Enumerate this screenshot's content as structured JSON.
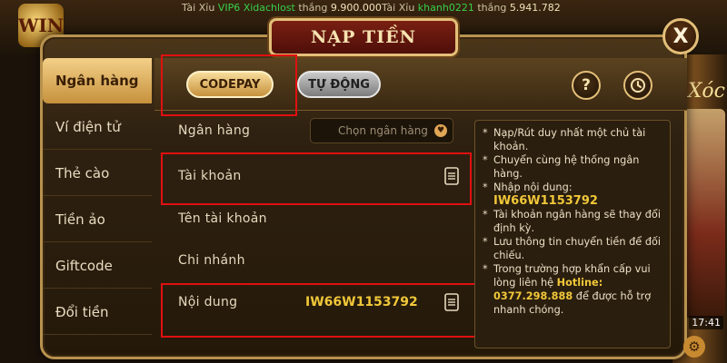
{
  "ticker": [
    {
      "prefix": "Tài Xỉu",
      "user": "VIP6 Xidachlost",
      "mid": "thắng",
      "amount": "9.900.000"
    },
    {
      "prefix": "Tài Xỉu",
      "user": "khanh0221",
      "mid": "thắng",
      "amount": "5.941.782"
    }
  ],
  "logo_text": "WIN",
  "side": {
    "title": "Xóc",
    "time": "17:41"
  },
  "dialog": {
    "title": "NẠP TIỀN",
    "close": "X"
  },
  "nav": [
    "Ngân hàng",
    "Ví điện tử",
    "Thẻ cào",
    "Tiền ảo",
    "Giftcode",
    "Đổi tiền"
  ],
  "tabs": {
    "codepay": "CODEPAY",
    "auto": "TỰ ĐỘNG",
    "help": "?"
  },
  "form": {
    "bank_label": "Ngân hàng",
    "bank_placeholder": "Chọn ngân hàng",
    "account_label": "Tài khoản",
    "account_name_label": "Tên tài khoản",
    "branch_label": "Chi nhánh",
    "content_label": "Nội dung",
    "content_value": "IW66W1153792"
  },
  "notes": {
    "n1": "Nạp/Rút duy nhất một chủ tài khoản.",
    "n2": "Chuyển cùng hệ thống ngân hàng.",
    "n3_prefix": "Nhập nội dung:",
    "n3_code": "IW66W1153792",
    "n4": "Tài khoản ngân hàng sẽ thay đổi định kỳ.",
    "n5": "Lưu thông tin chuyển tiền để đối chiếu.",
    "n6_prefix": "Trong trường hợp khẩn cấp vui lòng liên hệ",
    "n6_hotline": "Hotline: 0377.298.888",
    "n6_suffix": "để được hỗ trợ nhanh chóng."
  },
  "colors": {
    "accent": "#f1c739",
    "highlight": "#e01010",
    "frame": "#b8924f"
  }
}
